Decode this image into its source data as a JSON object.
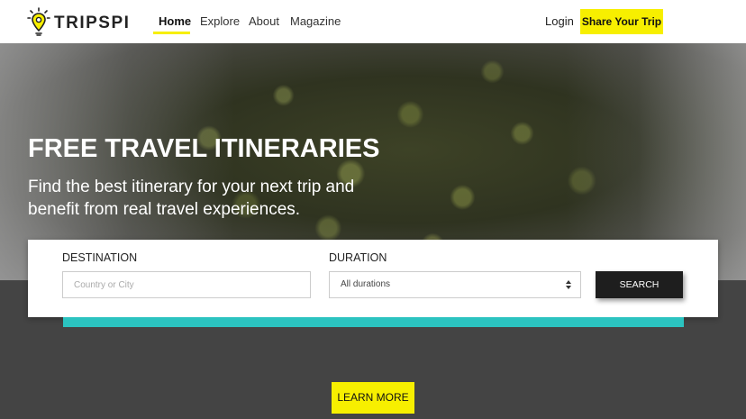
{
  "brand": {
    "name": "TRIPSPI",
    "logo_icon": "lightbulb-pin-icon",
    "accent": "#f7ef00"
  },
  "nav": {
    "items": [
      {
        "label": "Home",
        "active": true
      },
      {
        "label": "Explore",
        "active": false
      },
      {
        "label": "About",
        "active": false
      },
      {
        "label": "Magazine",
        "active": false
      }
    ],
    "login_label": "Login",
    "share_label": "Share Your Trip"
  },
  "hero": {
    "title": "FREE TRAVEL ITINERARIES",
    "subtitle": "Find the best itinerary for your next trip and benefit from real travel experiences."
  },
  "search": {
    "destination_label": "DESTINATION",
    "destination_placeholder": "Country or City",
    "destination_value": "",
    "duration_label": "DURATION",
    "duration_selected": "All durations",
    "search_label": "SEARCH"
  },
  "colors": {
    "teal_bar": "#2bc3c0",
    "background": "#444444",
    "search_button": "#1e1e1e"
  },
  "cta": {
    "learn_more_label": "LEARN MORE"
  }
}
